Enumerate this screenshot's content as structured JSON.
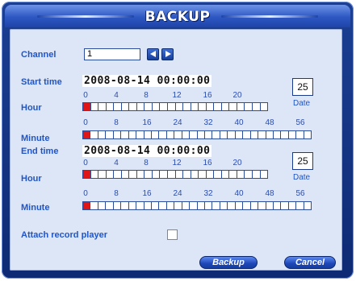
{
  "window": {
    "title": "BACKUP"
  },
  "channel": {
    "label": "Channel",
    "value": "1"
  },
  "start": {
    "label": "Start time",
    "datetime": "2008-08-14 00:00:00",
    "date_box": "25",
    "date_label": "Date",
    "hour_label": "Hour",
    "minute_label": "Minute",
    "hour_scale": [
      "0",
      "4",
      "8",
      "12",
      "16",
      "20"
    ],
    "minute_scale": [
      "0",
      "8",
      "16",
      "24",
      "32",
      "40",
      "48",
      "56"
    ]
  },
  "end": {
    "label": "End time",
    "datetime": "2008-08-14 00:00:00",
    "date_box": "25",
    "date_label": "Date",
    "hour_label": "Hour",
    "minute_label": "Minute",
    "hour_scale": [
      "0",
      "4",
      "8",
      "12",
      "16",
      "20"
    ],
    "minute_scale": [
      "0",
      "8",
      "16",
      "24",
      "32",
      "40",
      "48",
      "56"
    ]
  },
  "attach": {
    "label": "Attach record player",
    "checked": false
  },
  "buttons": {
    "backup": "Backup",
    "cancel": "Cancel"
  },
  "icons": {
    "prev": "arrow-left-icon",
    "next": "arrow-right-icon"
  },
  "colors": {
    "frame": "#1c3f93",
    "panel": "#dde6f7",
    "label": "#1f55c8",
    "active_cell": "#e01515"
  }
}
